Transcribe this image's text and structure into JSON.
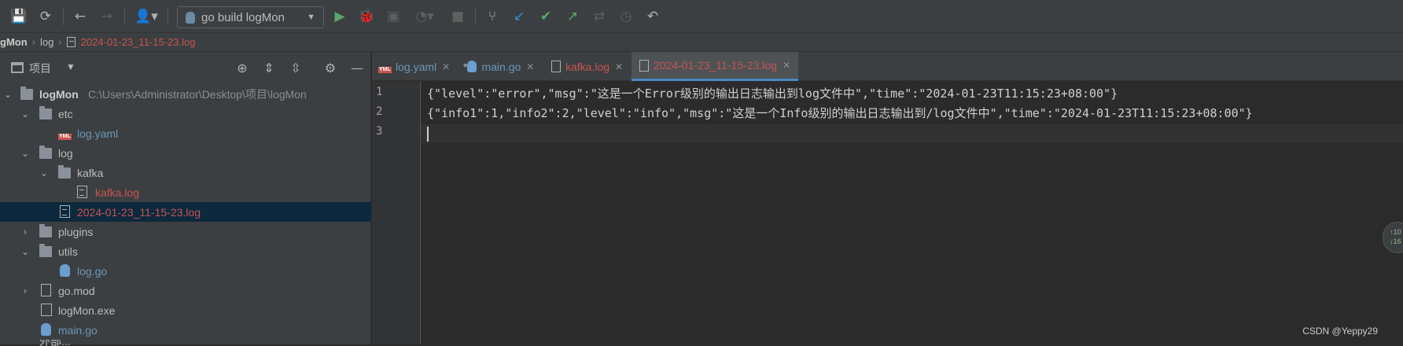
{
  "toolbar": {
    "run_config_label": "go build logMon",
    "icons": [
      "save-icon",
      "sync-icon",
      "back-icon",
      "forward-icon",
      "user-icon",
      "run-icon",
      "debug-icon",
      "coverage-icon",
      "profile-icon",
      "stop-icon",
      "branch-icon",
      "vcs-update-icon",
      "vcs-commit-icon",
      "vcs-push-icon",
      "compare-icon",
      "history-icon",
      "rollback-icon"
    ]
  },
  "breadcrumb": {
    "project": "gMon",
    "folder": "log",
    "file": "2024-01-23_11-15-23.log"
  },
  "project_panel": {
    "title": "项目",
    "tree": [
      {
        "name": "logMon",
        "path": "C:\\Users\\Administrator\\Desktop\\项目\\logMon"
      },
      {
        "name": "etc"
      },
      {
        "name": "log.yaml"
      },
      {
        "name": "log"
      },
      {
        "name": "kafka"
      },
      {
        "name": "kafka.log"
      },
      {
        "name": "2024-01-23_11-15-23.log"
      },
      {
        "name": "plugins"
      },
      {
        "name": "utils"
      },
      {
        "name": "log.go"
      },
      {
        "name": "go.mod"
      },
      {
        "name": "logMon.exe"
      },
      {
        "name": "main.go"
      },
      {
        "name": "外部..."
      }
    ]
  },
  "tabs": [
    {
      "label": "log.yaml"
    },
    {
      "label": "main.go",
      "modified_marker": "*"
    },
    {
      "label": "kafka.log"
    },
    {
      "label": "2024-01-23_11-15-23.log",
      "active": true
    }
  ],
  "editor": {
    "lines": [
      {
        "number": "1",
        "text": "{\"level\":\"error\",\"msg\":\"这是一个Error级别的输出日志输出到log文件中\",\"time\":\"2024-01-23T11:15:23+08:00\"}"
      },
      {
        "number": "2",
        "text": "{\"info1\":1,\"info2\":2,\"level\":\"info\",\"msg\":\"这是一个Info级别的输出日志输出到/log文件中\",\"time\":\"2024-01-23T11:15:23+08:00\"}"
      },
      {
        "number": "3",
        "text": ""
      }
    ]
  },
  "side_badge": {
    "line1": "↑10",
    "line2": "↓16"
  },
  "watermark": "CSDN @Yeppy29",
  "colors": {
    "accent": "#4a88c7",
    "error_file": "#c75450",
    "link_file": "#6897bb",
    "selection": "#0d293e"
  }
}
